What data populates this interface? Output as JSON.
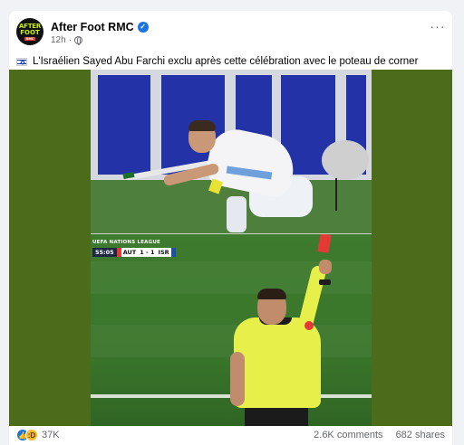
{
  "post": {
    "page_name": "After Foot RMC",
    "time": "12h",
    "avatar_text": [
      "AFTER",
      "FOOT",
      "RMC"
    ],
    "caption": "L'Israélien Sayed Abu Farchi exclu après cette célébration avec le poteau de corner",
    "caption_flag": "israel-flag-icon"
  },
  "video": {
    "league_label": "UEFA NATIONS LEAGUE",
    "scoreboard": {
      "clock": "55:05",
      "home_team": "AUT",
      "score": "1 - 1",
      "away_team": "ISR"
    }
  },
  "footer": {
    "reaction_count": "37K",
    "comments": "2.6K comments",
    "shares": "682 shares"
  },
  "colors": {
    "verified": "#1b74e4",
    "media_bg": "#4c6b1b",
    "referee_kit": "#e7f04a",
    "red_card": "#e53935"
  }
}
